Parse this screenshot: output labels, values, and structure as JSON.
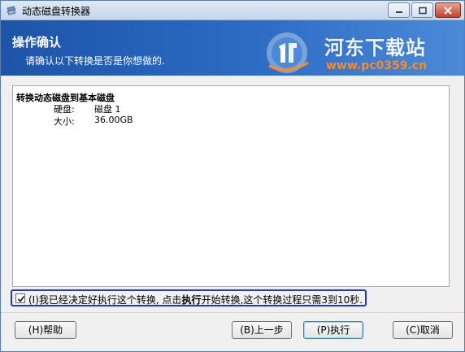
{
  "window": {
    "title": "动态磁盘转换器"
  },
  "header": {
    "title": "操作确认",
    "subtitle": "请确认以下转换是否是你想做的."
  },
  "watermark": {
    "site_name": "河东下载站",
    "url": "www.pc0359.cn"
  },
  "panel": {
    "heading": "转换动态磁盘到基本磁盘",
    "rows": [
      {
        "label": "硬盘:",
        "value": "磁盘 1"
      },
      {
        "label": "大小:",
        "value": "36.00GB"
      }
    ]
  },
  "confirm": {
    "checked": true,
    "text_prefix": "(I)我已经决定好执行这个转换, 点击",
    "text_bold": "执行",
    "text_suffix": "开始转换,这个转换过程只需3到10秒."
  },
  "buttons": {
    "help": "(H)帮助",
    "back": "(B)上一步",
    "execute": "(P)执行",
    "cancel": "(C)取消"
  },
  "colors": {
    "header_bg": "#1d54a8",
    "confirm_border": "#1f3db8",
    "watermark_url": "#ff8a1c"
  }
}
